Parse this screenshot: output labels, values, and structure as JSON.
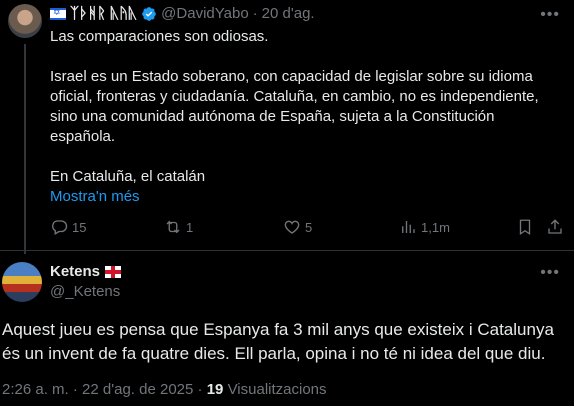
{
  "tweet1": {
    "display_name": "ᛉᚦᚻᚱ ᚣᚤᚣ",
    "handle": "@DavidYabo",
    "separator": "·",
    "date": "20 d'ag.",
    "more_icon": "more-horizontal-icon",
    "paragraphs": [
      "Las comparaciones son odiosas.",
      "Israel es un Estado soberano, con capacidad de legislar sobre su idioma oficial, fronteras y ciudadanía. Cataluña, en cambio, no es independiente, sino una comunidad autónoma de España, sujeta a la Constitución española.",
      "En Cataluña, el catalán"
    ],
    "show_more": "Mostra'n més",
    "actions": {
      "replies": "15",
      "reposts": "1",
      "likes": "5",
      "views": "1,1m"
    }
  },
  "tweet2": {
    "display_name": "Ketens",
    "handle": "@_Ketens",
    "text": "Aquest jueu es pensa que Espanya fa 3 mil anys que existeix i Catalunya és un invent de fa quatre dies. Ell parla, opina i no té ni idea del que diu.",
    "time": "2:26 a. m.",
    "separator": "·",
    "date": "22 d'ag. de 2025",
    "views_count": "19",
    "views_label": "Visualitzacions"
  },
  "colors": {
    "background": "#000000",
    "text": "#e7e9ea",
    "muted": "#71767b",
    "link": "#1d9bf0",
    "divider": "#2f3336"
  }
}
